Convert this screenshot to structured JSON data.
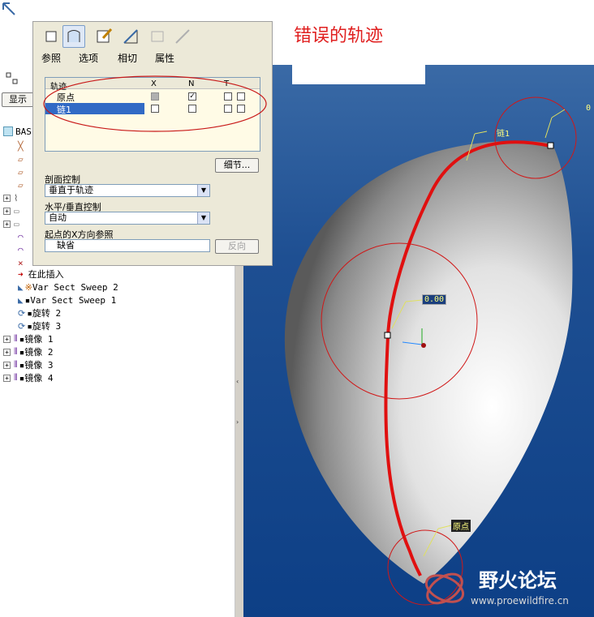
{
  "dashboard": {
    "tabs": [
      "参照",
      "选项",
      "相切",
      "属性"
    ],
    "table": {
      "header": {
        "traj": "轨迹",
        "x": "X",
        "n": "N",
        "t": "T"
      },
      "rows": [
        {
          "name": "原点",
          "x": "gray",
          "n": true
        },
        {
          "name": "链1",
          "x": false,
          "n": false,
          "selected": true
        }
      ]
    },
    "details_button": "细节...",
    "section_control_label": "剖面控制",
    "section_control_value": "垂直于轨迹",
    "hv_control_label": "水平/垂直控制",
    "hv_control_value": "自动",
    "x_ref_label": "起点的X方向参照",
    "x_ref_value": "缺省",
    "flip_button": "反向"
  },
  "annotation": {
    "title": "错误的轨迹"
  },
  "left_panel": {
    "display_button": "显示",
    "tree_root": "BAS"
  },
  "tree": {
    "insert_here": "在此插入",
    "items": [
      "Var Sect Sweep 2",
      "Var Sect Sweep 1",
      "旋转 2",
      "旋转 3",
      "镜像 1",
      "镜像 2",
      "镜像 3",
      "镜像 4"
    ]
  },
  "viewport": {
    "labels": {
      "chain": "链1",
      "origin": "原点",
      "value_top": "0",
      "value_mid": "0.00"
    }
  },
  "watermark": {
    "title": "野火论坛",
    "url": "www.proewildfire.cn"
  },
  "colors": {
    "trajectory": "#e01010",
    "viewport_bg": "#0d3f86",
    "note": "#e02020"
  }
}
